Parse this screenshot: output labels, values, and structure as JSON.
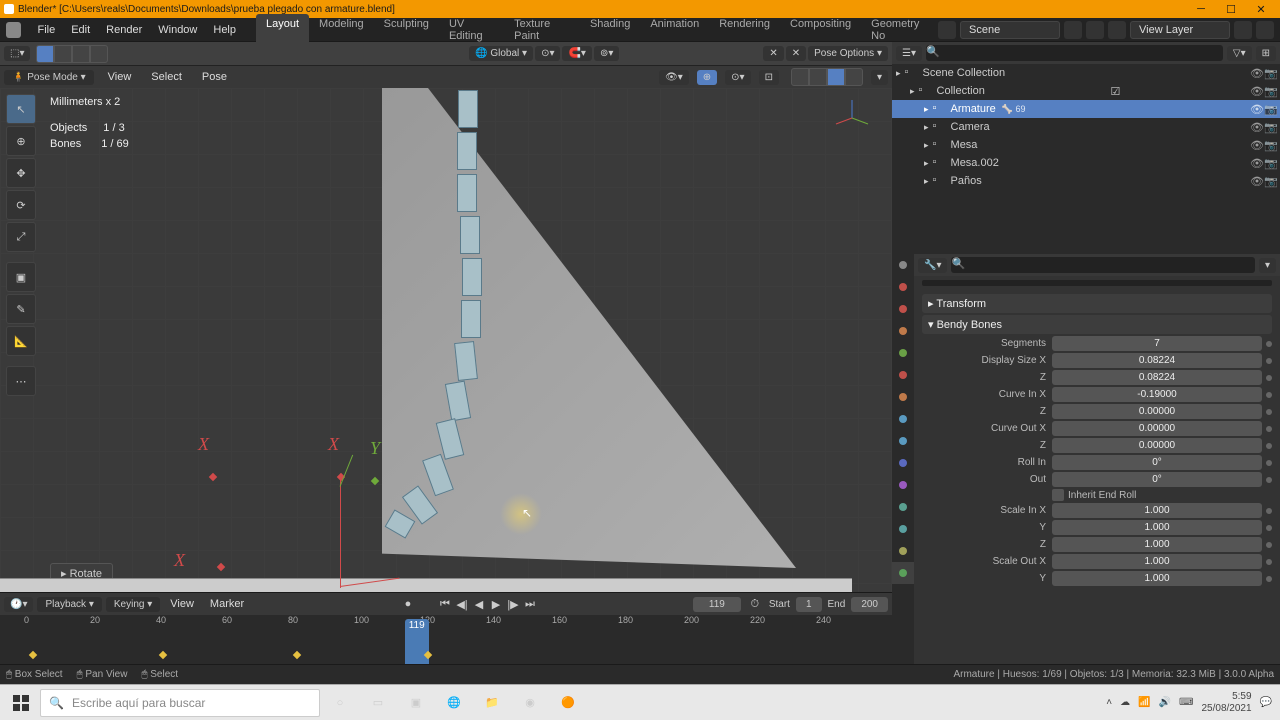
{
  "title": "Blender* [C:\\Users\\reals\\Documents\\Downloads\\prueba plegado con armature.blend]",
  "menubar": {
    "items": [
      "File",
      "Edit",
      "Render",
      "Window",
      "Help"
    ],
    "tabs": [
      "Layout",
      "Modeling",
      "Sculpting",
      "UV Editing",
      "Texture Paint",
      "Shading",
      "Animation",
      "Rendering",
      "Compositing",
      "Geometry No"
    ],
    "active_tab": 0,
    "scene": "Scene",
    "layer": "View Layer"
  },
  "viewport_header": {
    "orientation": "Global",
    "pose_options": "Pose Options"
  },
  "sec_header": {
    "mode": "Pose Mode",
    "items": [
      "View",
      "Select",
      "Pose"
    ]
  },
  "info": {
    "title": "Millimeters x 2",
    "objects_label": "Objects",
    "objects": "1 / 3",
    "bones_label": "Bones",
    "bones": "1 / 69"
  },
  "rotate_panel": "Rotate",
  "timeline": {
    "dropdowns": [
      "Playback",
      "Keying"
    ],
    "menus": [
      "View",
      "Marker"
    ],
    "ticks": [
      0,
      20,
      40,
      60,
      80,
      100,
      120,
      140,
      160,
      180,
      200,
      220,
      240
    ],
    "current": "119",
    "start_label": "Start",
    "start": "1",
    "end_label": "End",
    "end": "200",
    "keys": [
      30,
      160,
      294,
      425
    ]
  },
  "statusbar": {
    "items": [
      "Box Select",
      "Pan View",
      "Select"
    ],
    "stats": "Armature | Huesos: 1/69 | Objetos: 1/3 | Memoria: 32.3 MiB | 3.0.0 Alpha"
  },
  "outliner": {
    "root": "Scene Collection",
    "collection": "Collection",
    "items": [
      {
        "name": "Armature",
        "selected": true,
        "badge": "69"
      },
      {
        "name": "Camera"
      },
      {
        "name": "Mesa"
      },
      {
        "name": "Mesa.002"
      },
      {
        "name": "Paños"
      }
    ]
  },
  "props": {
    "sections": [
      "Transform",
      "Bendy Bones"
    ],
    "fields": [
      {
        "label": "Segments",
        "value": "7"
      },
      {
        "label": "Display Size X",
        "value": "0.08224"
      },
      {
        "label": "Z",
        "value": "0.08224"
      },
      {
        "label": "Curve In X",
        "value": "-0.19000"
      },
      {
        "label": "Z",
        "value": "0.00000"
      },
      {
        "label": "Curve Out X",
        "value": "0.00000"
      },
      {
        "label": "Z",
        "value": "0.00000"
      },
      {
        "label": "Roll In",
        "value": "0°"
      },
      {
        "label": "Out",
        "value": "0°"
      },
      {
        "label": "Inherit End Roll",
        "value": "",
        "checkbox": true
      },
      {
        "label": "Scale In X",
        "value": "1.000"
      },
      {
        "label": "Y",
        "value": "1.000"
      },
      {
        "label": "Z",
        "value": "1.000"
      },
      {
        "label": "Scale Out X",
        "value": "1.000"
      },
      {
        "label": "Y",
        "value": "1.000"
      }
    ],
    "tab_colors": [
      "#888",
      "#c0504a",
      "#c0504a",
      "#c07a4a",
      "#6aa046",
      "#c0504a",
      "#c07a4a",
      "#5a9ac0",
      "#5a9ac0",
      "#5a6ac0",
      "#9a5ac0",
      "#5aa090",
      "#5aa0a0",
      "#a0a05a",
      "#5aa05a"
    ]
  },
  "taskbar": {
    "search_placeholder": "Escribe aquí para buscar",
    "time": "5:59",
    "date": "25/08/2021"
  }
}
